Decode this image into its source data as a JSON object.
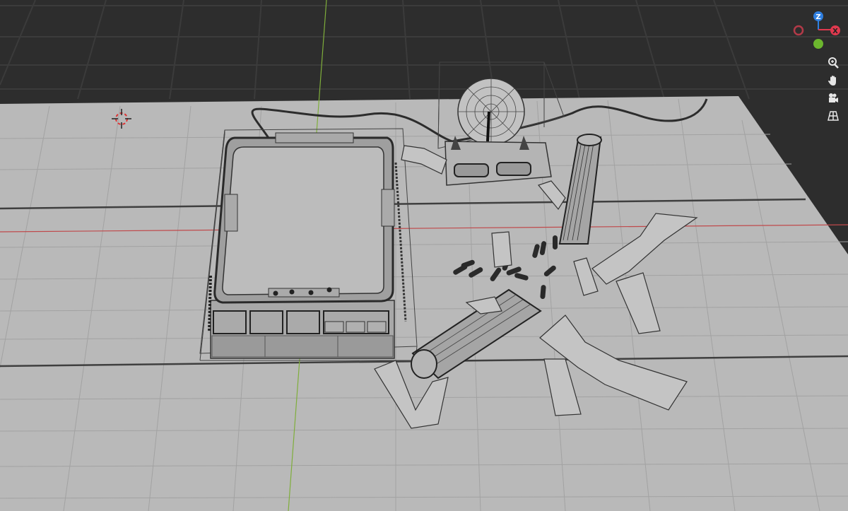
{
  "viewport": {
    "name": "3D Viewport",
    "mode": "wireframe"
  },
  "gizmo": {
    "axes": [
      {
        "label": "Z",
        "color": "#2f7fe0"
      },
      {
        "label": "X",
        "color": "#e0394e"
      },
      {
        "label": "Y",
        "color": "#6cb62e"
      }
    ],
    "negative_x_color": "#b23a48"
  },
  "nav_tools": [
    {
      "icon": "zoom-icon"
    },
    {
      "icon": "hand-pan-icon"
    },
    {
      "icon": "camera-view-icon"
    },
    {
      "icon": "grid-ortho-icon"
    }
  ],
  "colors": {
    "world_background": "#2d2d2d",
    "floor": "#b9b9b9",
    "grid_line": "#9a9a9a",
    "x_axis": "#c0494b",
    "y_axis": "#7fae3b",
    "wire": "#3a3a3a"
  }
}
